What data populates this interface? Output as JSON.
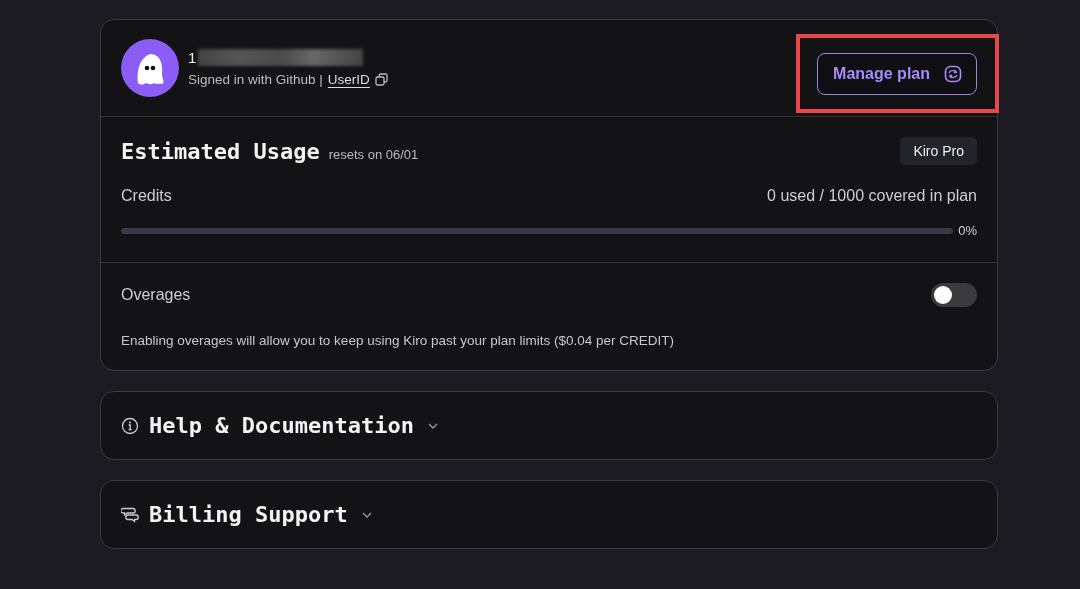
{
  "account": {
    "name": "1",
    "redacted": true,
    "signed_in_text": "Signed in with Github |",
    "user_id_link": "UserID"
  },
  "manage_plan": {
    "label": "Manage plan",
    "highlighted": true
  },
  "usage": {
    "title": "Estimated Usage",
    "resets": "resets on 06/01",
    "plan_badge": "Kiro Pro",
    "credits_label": "Credits",
    "credits_summary": "0 used / 1000 covered in plan",
    "level": 0,
    "percent": "0%"
  },
  "overages": {
    "label": "Overages",
    "on": false,
    "description": "Enabling overages will allow you to keep using Kiro past your plan limits ($0.04 per CREDIT)"
  },
  "sections": [
    {
      "kind": "info",
      "title": "Help & Documentation",
      "expanded": false
    },
    {
      "kind": "chat",
      "title": "Billing Support",
      "expanded": false
    }
  ]
}
